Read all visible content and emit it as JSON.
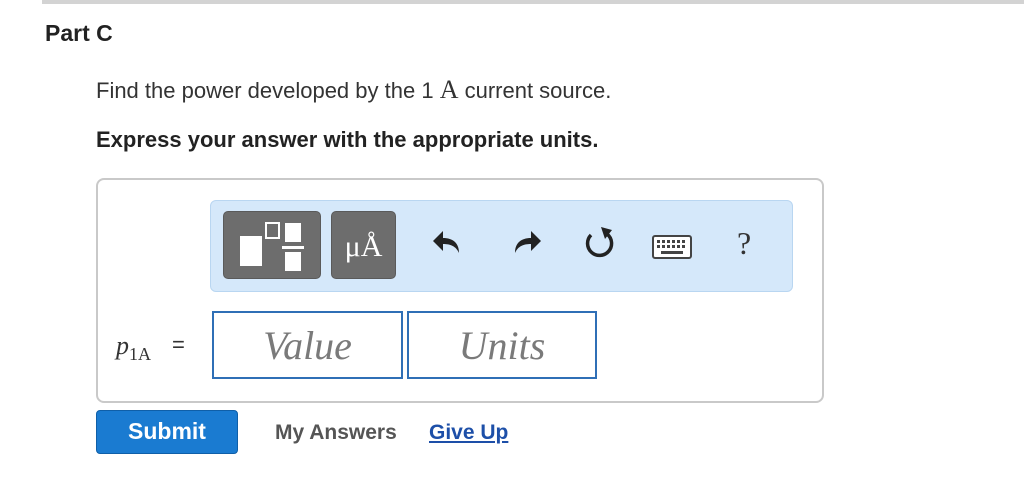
{
  "part": {
    "title": "Part C"
  },
  "question": {
    "text_before": "Find the power developed by the 1 ",
    "unit_symbol": "A",
    "text_after": " current source."
  },
  "instruction": "Express your answer with the appropriate units.",
  "toolbar": {
    "units_label": "μÅ",
    "help_label": "?",
    "icons": [
      "templates-icon",
      "undo-icon",
      "redo-icon",
      "reset-icon",
      "keyboard-icon",
      "help-icon"
    ]
  },
  "answer": {
    "variable": "p",
    "subscript": "1A",
    "equals": "=",
    "value_placeholder": "Value",
    "units_placeholder": "Units"
  },
  "actions": {
    "submit": "Submit",
    "my_answers": "My Answers",
    "give_up": "Give Up"
  },
  "colors": {
    "toolbar_bg": "#d5e8fa",
    "field_border": "#2f6fb6",
    "submit_bg": "#1a7bd1",
    "link": "#1d4fa8"
  }
}
